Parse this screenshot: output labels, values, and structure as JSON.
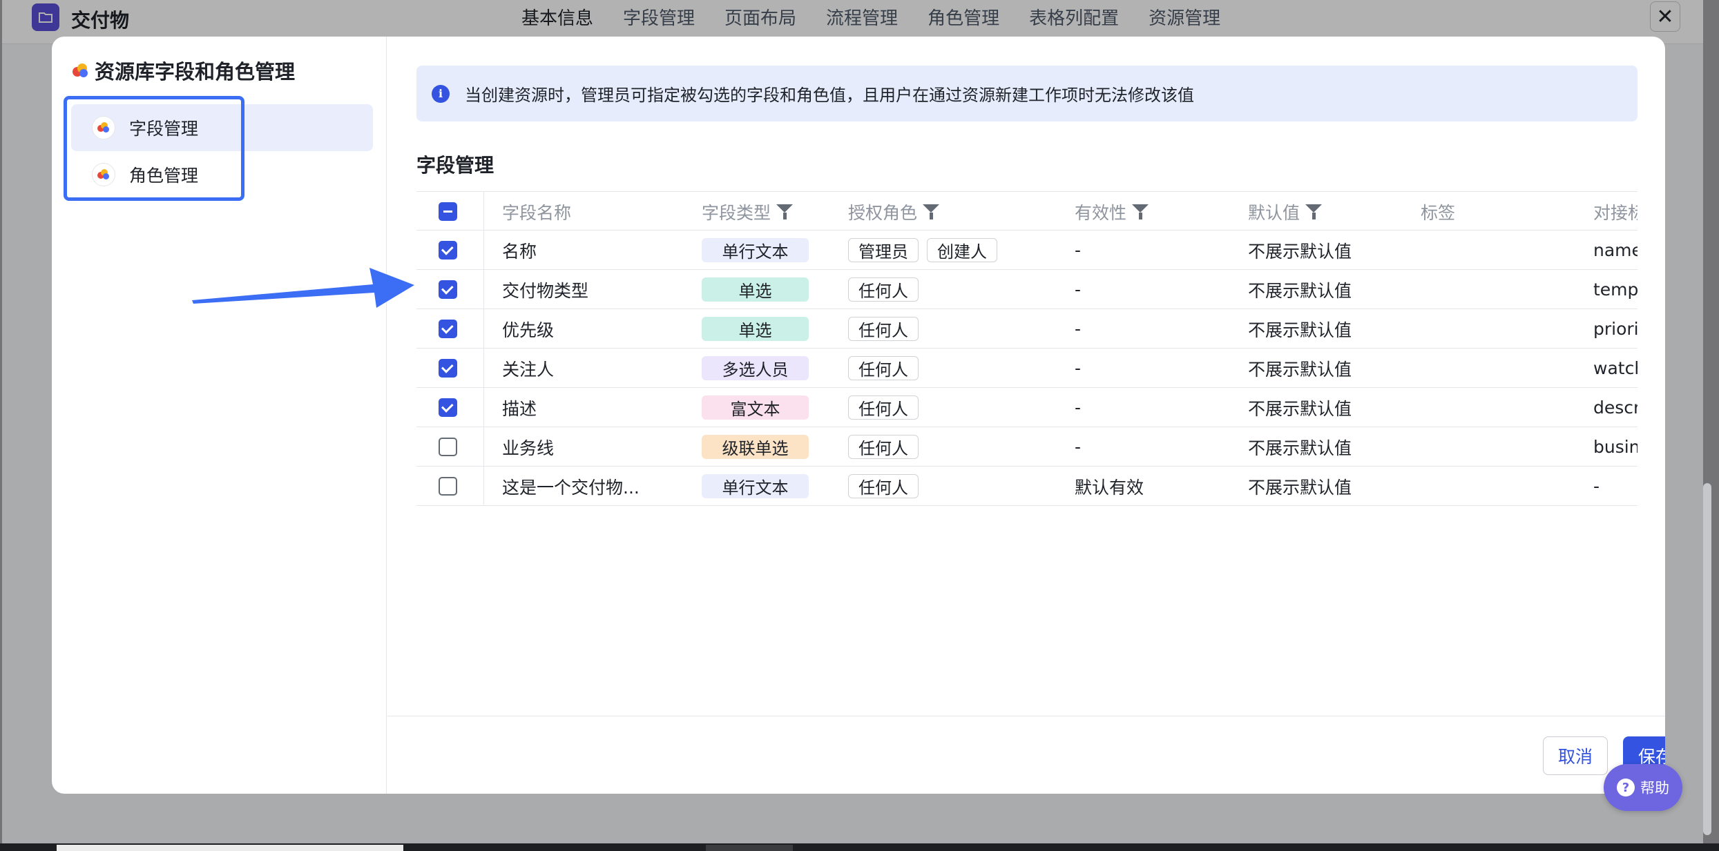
{
  "app": {
    "title": "交付物",
    "tabs": [
      "基本信息",
      "字段管理",
      "页面布局",
      "流程管理",
      "角色管理",
      "表格列配置",
      "资源管理"
    ],
    "close_label": "✕"
  },
  "sidebar": {
    "title": "资源库字段和角色管理",
    "items": [
      {
        "label": "字段管理",
        "active": true
      },
      {
        "label": "角色管理",
        "active": false
      }
    ]
  },
  "alert": {
    "icon": "info-icon",
    "text": "当创建资源时，管理员可指定被勾选的字段和角色值，且用户在通过资源新建工作项时无法修改该值"
  },
  "section_title": "字段管理",
  "table": {
    "headers": {
      "name": "字段名称",
      "type": "字段类型",
      "roles": "授权角色",
      "validity": "有效性",
      "default": "默认值",
      "tag": "标签",
      "api": "对接标"
    },
    "rows": [
      {
        "checked": true,
        "name": "名称",
        "type": "单行文本",
        "type_color": "#eaedfb",
        "roles": [
          "管理员",
          "创建人"
        ],
        "validity": "-",
        "default": "不展示默认值",
        "api": "name"
      },
      {
        "checked": true,
        "name": "交付物类型",
        "type": "单选",
        "type_color": "#caf0e8",
        "roles": [
          "任何人"
        ],
        "validity": "-",
        "default": "不展示默认值",
        "api": "templ"
      },
      {
        "checked": true,
        "name": "优先级",
        "type": "单选",
        "type_color": "#caf0e8",
        "roles": [
          "任何人"
        ],
        "validity": "-",
        "default": "不展示默认值",
        "api": "priori"
      },
      {
        "checked": true,
        "name": "关注人",
        "type": "多选人员",
        "type_color": "#ece6fd",
        "roles": [
          "任何人"
        ],
        "validity": "-",
        "default": "不展示默认值",
        "api": "watch"
      },
      {
        "checked": true,
        "name": "描述",
        "type": "富文本",
        "type_color": "#fbe0ed",
        "roles": [
          "任何人"
        ],
        "validity": "-",
        "default": "不展示默认值",
        "api": "descr"
      },
      {
        "checked": false,
        "name": "业务线",
        "type": "级联单选",
        "type_color": "#fde3c6",
        "roles": [
          "任何人"
        ],
        "validity": "-",
        "default": "不展示默认值",
        "api": "busin"
      },
      {
        "checked": false,
        "name": "这是一个交付物...",
        "type": "单行文本",
        "type_color": "#eaedfb",
        "roles": [
          "任何人"
        ],
        "validity": "默认有效",
        "default": "不展示默认值",
        "api": "-"
      }
    ]
  },
  "footer": {
    "cancel": "取消",
    "save": "保存"
  },
  "help": {
    "label": "帮助"
  },
  "colors": {
    "primary": "#3353e0",
    "highlight": "#3b6ef5",
    "help": "#6e66e0"
  }
}
